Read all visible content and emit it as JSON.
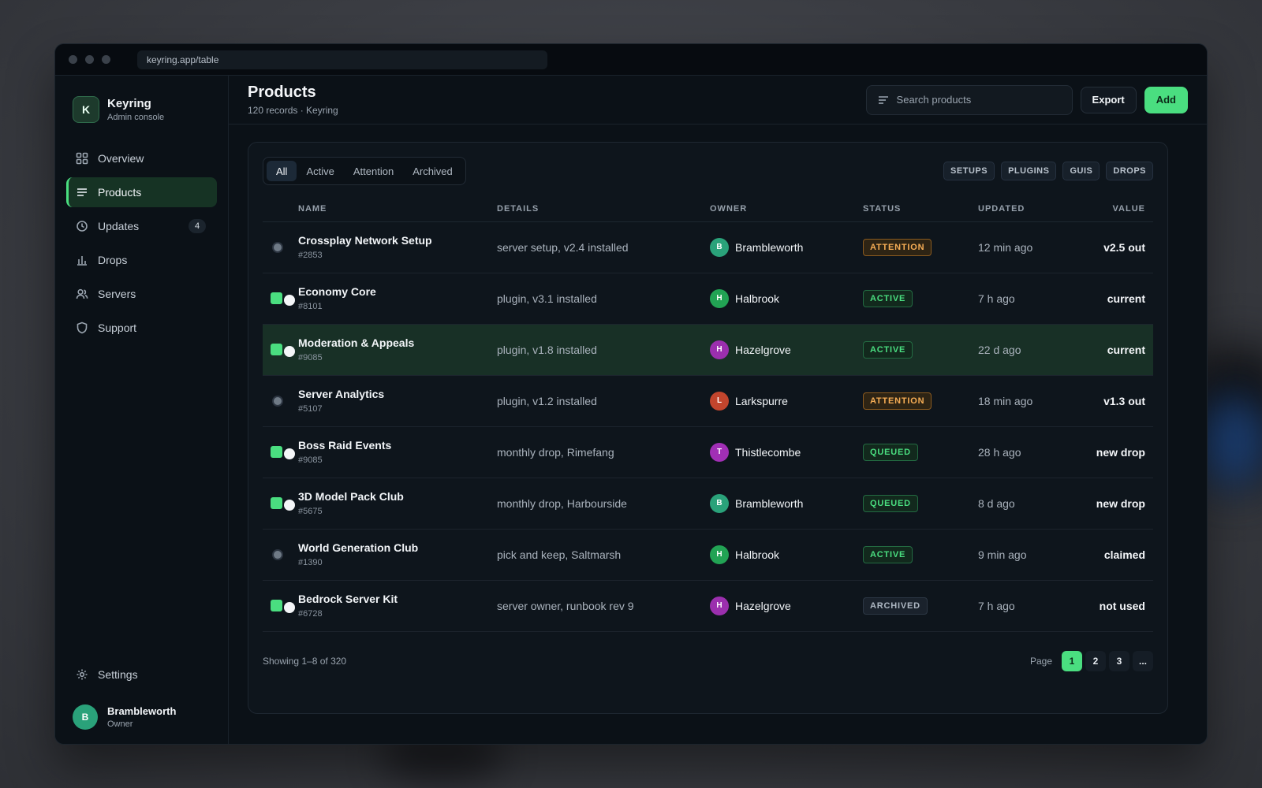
{
  "browser": {
    "url": "keyring.app/table"
  },
  "brand": {
    "logo_letter": "K",
    "name": "Keyring",
    "subtitle": "Admin console"
  },
  "sidebar": {
    "items": [
      {
        "label": "Overview",
        "icon": "grid-icon",
        "active": false
      },
      {
        "label": "Products",
        "icon": "list-icon",
        "active": true
      },
      {
        "label": "Updates",
        "icon": "clock-icon",
        "active": false,
        "badge": "4"
      },
      {
        "label": "Drops",
        "icon": "bar-chart-icon",
        "active": false
      },
      {
        "label": "Servers",
        "icon": "users-icon",
        "active": false
      },
      {
        "label": "Support",
        "icon": "shield-icon",
        "active": false
      }
    ],
    "settings_label": "Settings",
    "user": {
      "initial": "B",
      "name": "Brambleworth",
      "role": "Owner"
    }
  },
  "header": {
    "title": "Products",
    "subtitle": "120 records · Keyring",
    "search_placeholder": "Search products",
    "export_label": "Export",
    "add_label": "Add"
  },
  "filters": {
    "tabs": [
      {
        "label": "All",
        "active": true
      },
      {
        "label": "Active",
        "active": false
      },
      {
        "label": "Attention",
        "active": false
      },
      {
        "label": "Archived",
        "active": false
      }
    ],
    "chips": [
      "SETUPS",
      "PLUGINS",
      "GUIS",
      "DROPS"
    ]
  },
  "table": {
    "columns": [
      "NAME",
      "DETAILS",
      "OWNER",
      "STATUS",
      "UPDATED",
      "VALUE"
    ],
    "rows": [
      {
        "selector": "radio",
        "name": "Crossplay Network Setup",
        "id": "#2853",
        "details": "server setup, v2.4 installed",
        "owner": "Brambleworth",
        "owner_initial": "B",
        "owner_color": "#2aa27a",
        "status": "ATTENTION",
        "status_kind": "attention",
        "updated": "12 min ago",
        "value": "v2.5 out",
        "highlight": false
      },
      {
        "selector": "toggle",
        "name": "Economy Core",
        "id": "#8101",
        "details": "plugin, v3.1 installed",
        "owner": "Halbrook",
        "owner_initial": "H",
        "owner_color": "#22a354",
        "status": "ACTIVE",
        "status_kind": "active",
        "updated": "7 h ago",
        "value": "current",
        "highlight": false
      },
      {
        "selector": "toggle",
        "name": "Moderation & Appeals",
        "id": "#9085",
        "details": "plugin, v1.8 installed",
        "owner": "Hazelgrove",
        "owner_initial": "H",
        "owner_color": "#9b2fae",
        "status": "ACTIVE",
        "status_kind": "active",
        "updated": "22 d ago",
        "value": "current",
        "highlight": true
      },
      {
        "selector": "radio",
        "name": "Server Analytics",
        "id": "#5107",
        "details": "plugin, v1.2 installed",
        "owner": "Larkspurre",
        "owner_initial": "L",
        "owner_color": "#c2452d",
        "status": "ATTENTION",
        "status_kind": "attention",
        "updated": "18 min ago",
        "value": "v1.3 out",
        "highlight": false
      },
      {
        "selector": "toggle",
        "name": "Boss Raid Events",
        "id": "#9085",
        "details": "monthly drop, Rimefang",
        "owner": "Thistlecombe",
        "owner_initial": "T",
        "owner_color": "#a12fb5",
        "status": "QUEUED",
        "status_kind": "queued",
        "updated": "28 h ago",
        "value": "new drop",
        "highlight": false
      },
      {
        "selector": "toggle",
        "name": "3D Model Pack Club",
        "id": "#5675",
        "details": "monthly drop, Harbourside",
        "owner": "Brambleworth",
        "owner_initial": "B",
        "owner_color": "#2aa27a",
        "status": "QUEUED",
        "status_kind": "queued",
        "updated": "8 d ago",
        "value": "new drop",
        "highlight": false
      },
      {
        "selector": "radio",
        "name": "World Generation Club",
        "id": "#1390",
        "details": "pick and keep, Saltmarsh",
        "owner": "Halbrook",
        "owner_initial": "H",
        "owner_color": "#22a354",
        "status": "ACTIVE",
        "status_kind": "active",
        "updated": "9 min ago",
        "value": "claimed",
        "highlight": false
      },
      {
        "selector": "toggle",
        "name": "Bedrock Server Kit",
        "id": "#6728",
        "details": "server owner, runbook rev 9",
        "owner": "Hazelgrove",
        "owner_initial": "H",
        "owner_color": "#9b2fae",
        "status": "ARCHIVED",
        "status_kind": "archived",
        "updated": "7 h ago",
        "value": "not used",
        "highlight": false
      }
    ]
  },
  "footer": {
    "showing": "Showing 1–8 of 320",
    "page_label": "Page",
    "pages": [
      "1",
      "2",
      "3",
      "..."
    ],
    "current_page": "1"
  },
  "colors": {
    "accent": "#4ade80",
    "attention": "#f6ad55",
    "background": "#0b1117"
  }
}
